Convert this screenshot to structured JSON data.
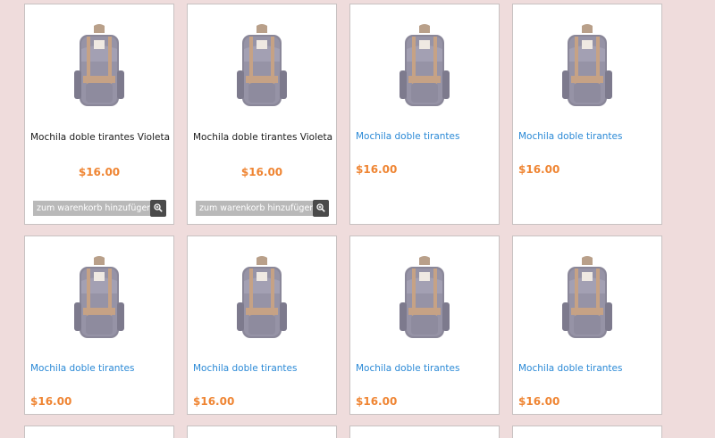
{
  "colors": {
    "background": "#efdcdc",
    "price": "#ef8533",
    "link": "#2a89d6",
    "cart_button": "#b9b9b9",
    "zoom_button": "#4a4a4a"
  },
  "products": [
    {
      "name": "Mochila doble tirantes Violeta",
      "price": "$16.00",
      "cart_label": "zum warenkorb hinzufügen",
      "image_icon": "backpack-icon",
      "zoom_icon": "zoom-in-icon"
    },
    {
      "name": "Mochila doble tirantes Violeta",
      "price": "$16.00",
      "cart_label": "zum warenkorb hinzufügen",
      "image_icon": "backpack-icon",
      "zoom_icon": "zoom-in-icon"
    },
    {
      "name": "Mochila doble tirantes",
      "price": "$16.00",
      "image_icon": "backpack-icon"
    },
    {
      "name": "Mochila doble tirantes",
      "price": "$16.00",
      "image_icon": "backpack-icon"
    },
    {
      "name": "Mochila doble tirantes",
      "price": "$16.00",
      "image_icon": "backpack-icon"
    },
    {
      "name": "Mochila doble tirantes",
      "price": "$16.00",
      "image_icon": "backpack-icon"
    },
    {
      "name": "Mochila doble tirantes",
      "price": "$16.00",
      "image_icon": "backpack-icon"
    },
    {
      "name": "Mochila doble tirantes",
      "price": "$16.00",
      "image_icon": "backpack-icon"
    }
  ]
}
